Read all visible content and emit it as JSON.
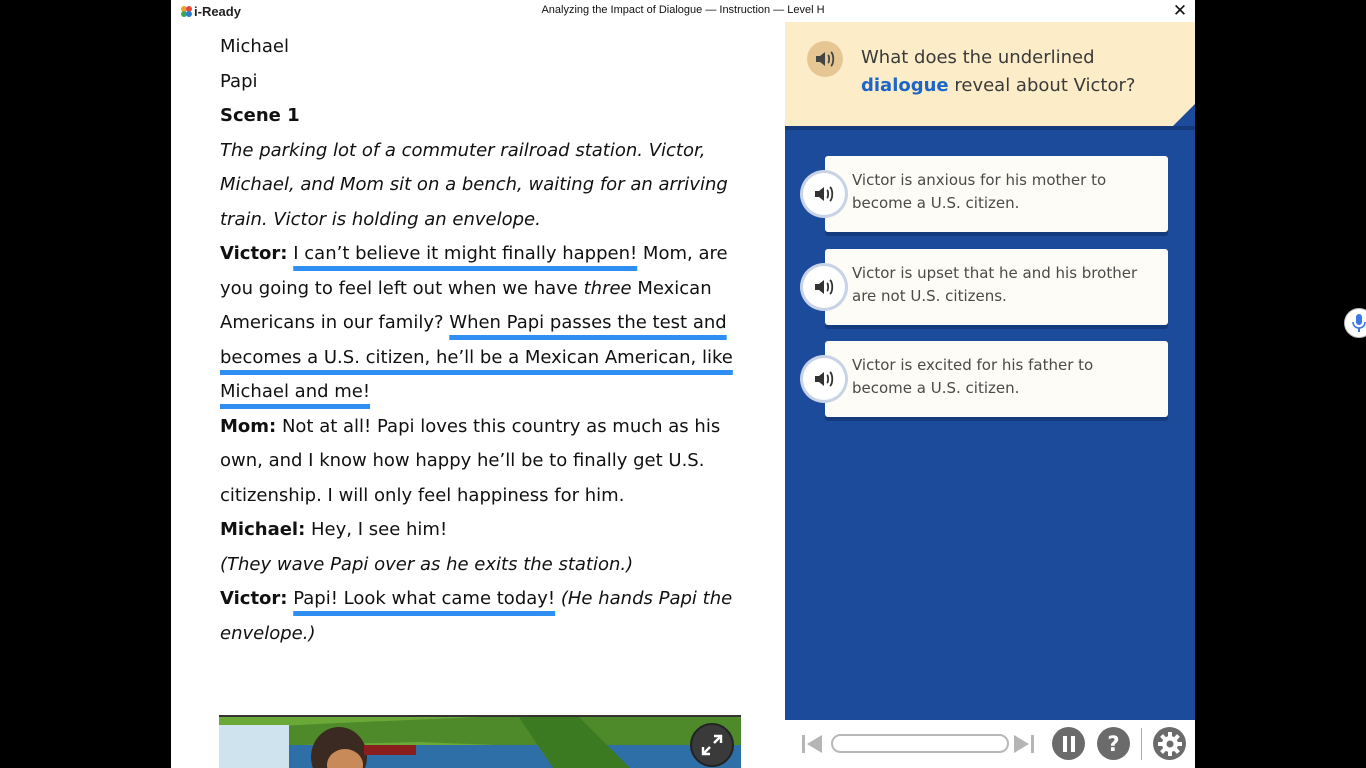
{
  "window": {
    "app_name": "i-Ready",
    "title": "Analyzing the Impact of Dialogue — Instruction — Level H",
    "close_glyph": "✕"
  },
  "reading": {
    "cast": [
      "Michael",
      "Papi"
    ],
    "scene_heading": "Scene 1",
    "stage_direction": "The parking lot of a commuter railroad station. Victor, Michael, and Mom sit on a bench, waiting for an arriving train. Victor is holding an envelope.",
    "line1": {
      "speaker": "Victor:",
      "u1": "I can’t believe it might finally happen!",
      "t1": " Mom, are you going to feel left out when we have ",
      "em": "three",
      "t2": " Mexican Americans in our family? ",
      "u2": "When Papi passes the test and becomes a U.S. citizen, he’ll be a Mexican American, like Michael and me!"
    },
    "line2": {
      "speaker": "Mom:",
      "text": " Not at all! Papi loves this country as much as his own, and I know how happy he’ll be to finally get U.S. citizenship. I will only feel happiness for him."
    },
    "line3": {
      "speaker": "Michael:",
      "text": " Hey, I see him!"
    },
    "direction2": "(They wave Papi over as he exits the station.)",
    "line4": {
      "speaker": "Victor:",
      "u1": "Papi! Look what came today!",
      "direction": " (He hands Papi the envelope.)"
    }
  },
  "question": {
    "prompt_before": "What does the underlined ",
    "keyword": "dialogue",
    "prompt_after": " reveal about Victor?",
    "choices": [
      {
        "text": "Victor is anxious for his mother to become a U.S. citizen."
      },
      {
        "text": "Victor is upset that he and his brother are not U.S. citizens."
      },
      {
        "text": "Victor is excited for his father to become a U.S. citizen."
      }
    ]
  },
  "nav": {
    "help_glyph": "?"
  },
  "colors": {
    "panel_blue": "#1c4b9c",
    "prompt_bg": "#fcecc7",
    "underline_blue": "#2f8ef2",
    "keyword_blue": "#1c66c9"
  }
}
